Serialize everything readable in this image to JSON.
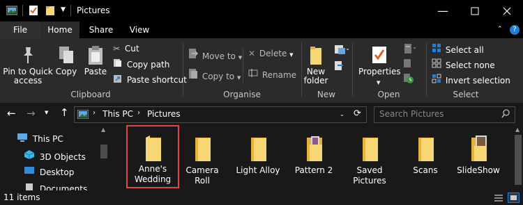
{
  "window": {
    "title": "Pictures"
  },
  "tabs": [
    "File",
    "Home",
    "Share",
    "View"
  ],
  "ribbon": {
    "clipboard": {
      "pin_label": "Pin to Quick\naccess",
      "copy_label": "Copy",
      "paste_label": "Paste",
      "cut_label": "Cut",
      "copy_path_label": "Copy path",
      "paste_shortcut_label": "Paste shortcut",
      "group_label": "Clipboard"
    },
    "organise": {
      "move_to_label": "Move to",
      "copy_to_label": "Copy to",
      "delete_label": "Delete",
      "rename_label": "Rename",
      "group_label": "Organise"
    },
    "new": {
      "new_folder_label": "New\nfolder",
      "group_label": "New"
    },
    "open": {
      "properties_label": "Properties",
      "group_label": "Open"
    },
    "select": {
      "select_all_label": "Select all",
      "select_none_label": "Select none",
      "invert_selection_label": "Invert selection",
      "group_label": "Select"
    }
  },
  "address": {
    "segments": [
      "This PC",
      "Pictures"
    ],
    "search_placeholder": "Search Pictures"
  },
  "nav": {
    "items": [
      "This PC",
      "3D Objects",
      "Desktop",
      "Documents"
    ]
  },
  "files": [
    {
      "name": "Anne's\nWedding",
      "type": "folder",
      "selected": true
    },
    {
      "name": "Camera\nRoll",
      "type": "folder",
      "selected": false
    },
    {
      "name": "Light Alloy",
      "type": "folder",
      "selected": false
    },
    {
      "name": "Pattern 2",
      "type": "folder-with-images",
      "selected": false
    },
    {
      "name": "Saved\nPictures",
      "type": "folder",
      "selected": false
    },
    {
      "name": "Scans",
      "type": "folder",
      "selected": false
    },
    {
      "name": "SlideShow",
      "type": "folder-with-images",
      "selected": false
    }
  ],
  "status": {
    "item_count": "11 items"
  },
  "colors": {
    "background": "#191919",
    "ribbon": "#2b2b2b",
    "folder": "#f7d674",
    "folder_dark": "#e3b23c",
    "selection_border": "#e04848",
    "accent": "#1e7fd8"
  }
}
